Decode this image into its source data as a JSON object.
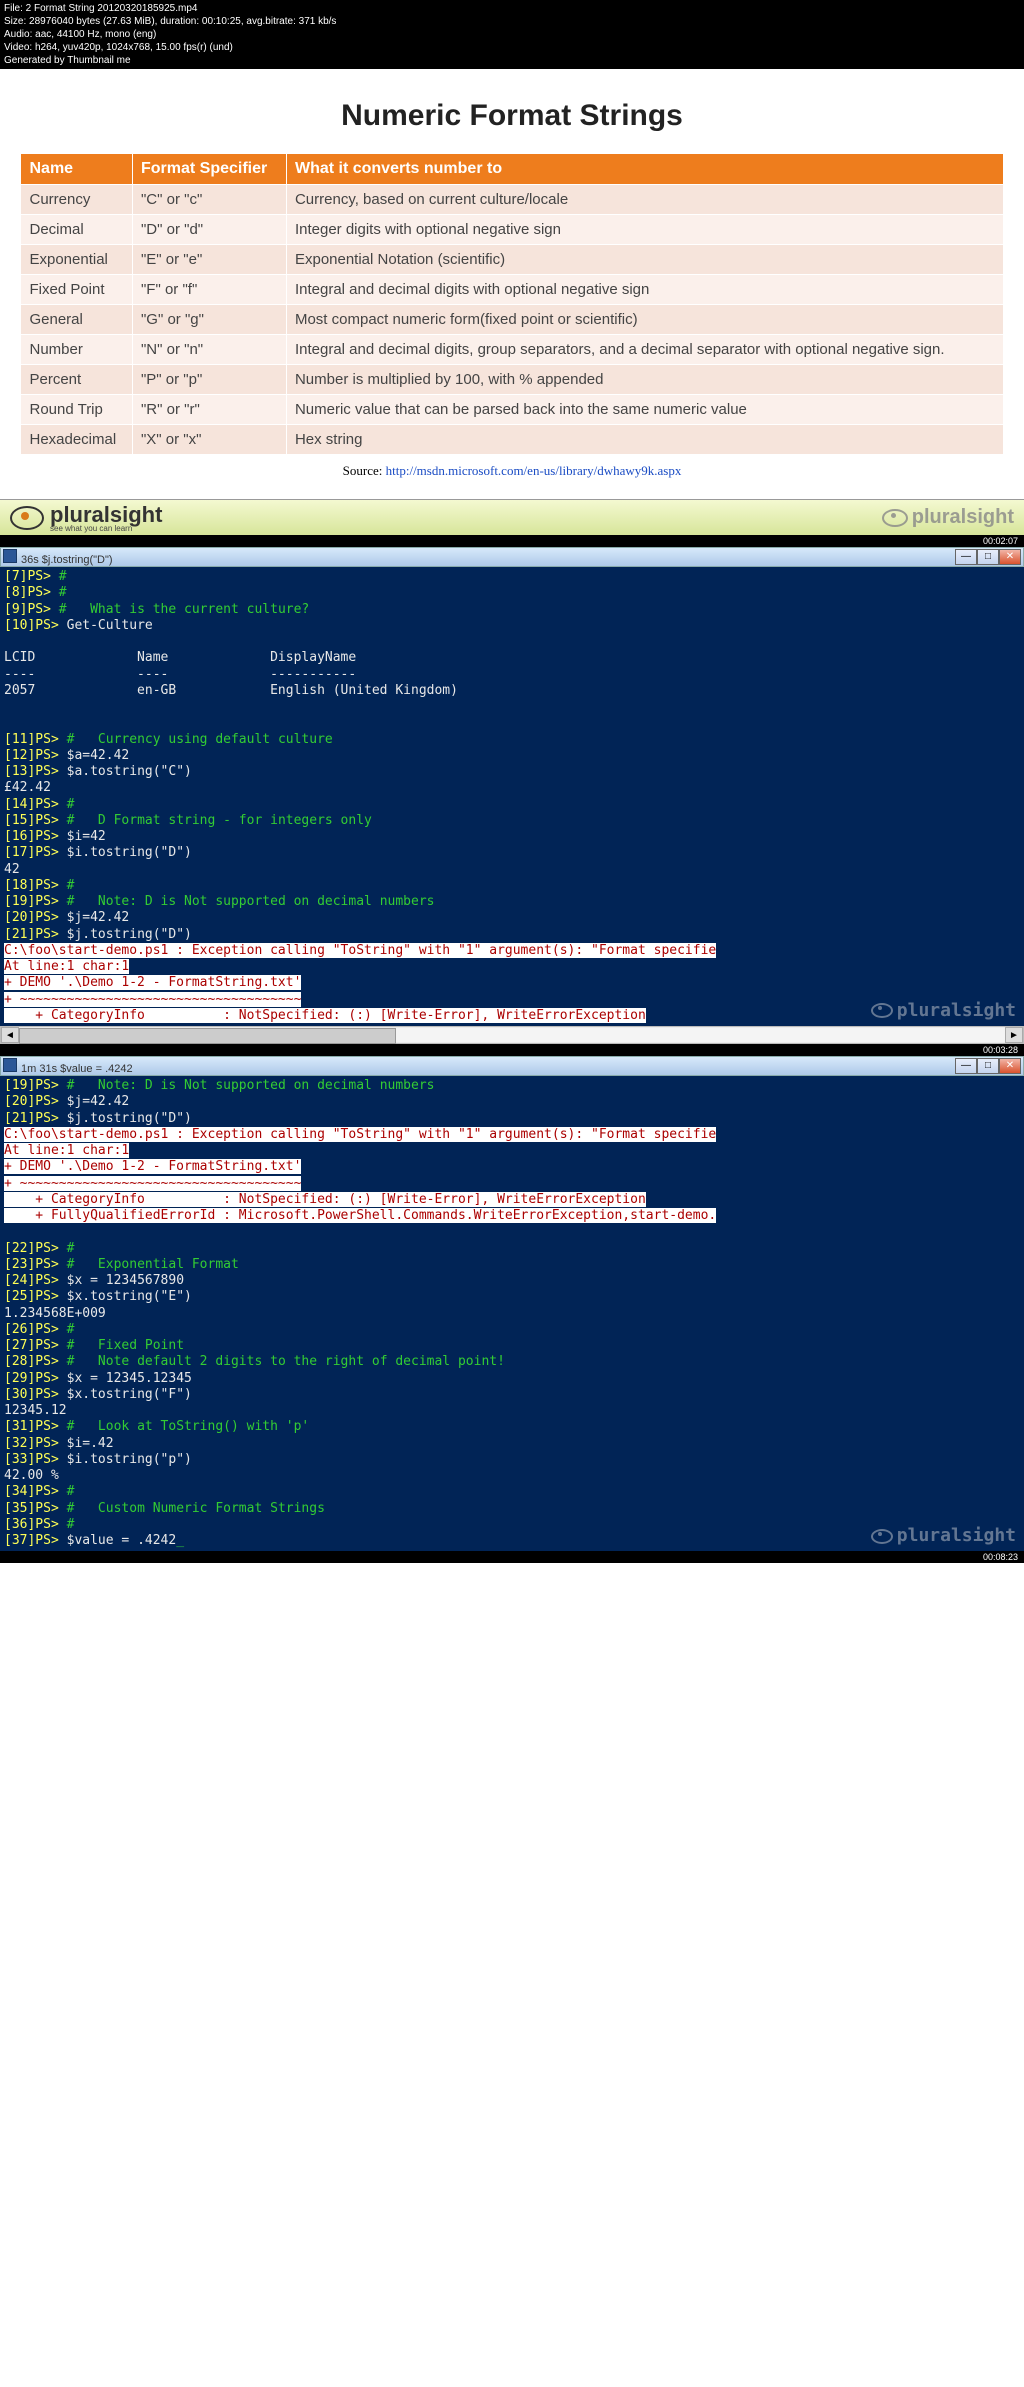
{
  "file_info": {
    "line1": "File: 2 Format String 20120320185925.mp4",
    "line2": "Size: 28976040 bytes (27.63 MiB), duration: 00:10:25, avg.bitrate: 371 kb/s",
    "line3": "Audio: aac, 44100 Hz, mono (eng)",
    "line4": "Video: h264, yuv420p, 1024x768, 15.00 fps(r) (und)",
    "line5": "Generated by Thumbnail me"
  },
  "slide": {
    "title": "Numeric Format Strings",
    "headers": {
      "c1": "Name",
      "c2": "Format Specifier",
      "c3": "What it converts number to"
    },
    "rows": [
      {
        "name": "Currency",
        "spec": "\"C\" or \"c\"",
        "desc": "Currency, based on current culture/locale"
      },
      {
        "name": "Decimal",
        "spec": "\"D\" or \"d\"",
        "desc": "Integer digits with optional negative sign"
      },
      {
        "name": "Exponential",
        "spec": "\"E\" or \"e\"",
        "desc": "Exponential Notation (scientific)"
      },
      {
        "name": "Fixed Point",
        "spec": "\"F\" or \"f\"",
        "desc": "Integral and decimal digits with optional negative sign"
      },
      {
        "name": "General",
        "spec": "\"G\" or \"g\"",
        "desc": "Most compact numeric form(fixed point or scientific)"
      },
      {
        "name": "Number",
        "spec": "\"N\" or \"n\"",
        "desc": "Integral and decimal digits, group separators, and a decimal separator with optional negative sign."
      },
      {
        "name": "Percent",
        "spec": "\"P\" or \"p\"",
        "desc": "Number is multiplied by 100, with % appended"
      },
      {
        "name": "Round Trip",
        "spec": "\"R\" or \"r\"",
        "desc": "Numeric value that can be parsed back into the same numeric value"
      },
      {
        "name": "Hexadecimal",
        "spec": "\"X\" or \"x\"",
        "desc": "Hex string"
      }
    ],
    "source_label": "Source: ",
    "source_url": "http://msdn.microsoft.com/en-us/library/dwhawy9k.aspx"
  },
  "brand": {
    "name": "pluralsight",
    "tag": "see what you can learn"
  },
  "frame2": {
    "timecode": "00:02:07",
    "win_title": "36s  $j.tostring(\"D\")",
    "lines": [
      {
        "p": "[7]PS>",
        "c": "#"
      },
      {
        "p": "[8]PS>",
        "c": "#"
      },
      {
        "p": "[9]PS>",
        "c": "#   What is the current culture?"
      },
      {
        "p": "[10]PS>",
        "c": "Get-Culture",
        "white": true
      }
    ],
    "table_header": "LCID             Name             DisplayName",
    "table_divider": "----             ----             -----------",
    "table_row": "2057             en-GB            English (United Kingdom)",
    "lines2": [
      {
        "p": "[11]PS>",
        "c": "#   Currency using default culture"
      },
      {
        "p": "[12]PS>",
        "c": "$a=42.42",
        "white": true
      },
      {
        "p": "[13]PS>",
        "c": "$a.tostring(\"C\")",
        "white": true
      }
    ],
    "out1": "£42.42",
    "lines3": [
      {
        "p": "[14]PS>",
        "c": "#"
      },
      {
        "p": "[15]PS>",
        "c": "#   D Format string - for integers only"
      },
      {
        "p": "[16]PS>",
        "c": "$i=42",
        "white": true
      },
      {
        "p": "[17]PS>",
        "c": "$i.tostring(\"D\")",
        "white": true
      }
    ],
    "out2": "42",
    "lines4": [
      {
        "p": "[18]PS>",
        "c": "#"
      },
      {
        "p": "[19]PS>",
        "c": "#   Note: D is Not supported on decimal numbers"
      },
      {
        "p": "[20]PS>",
        "c": "$j=42.42",
        "white": true
      },
      {
        "p": "[21]PS>",
        "c": "$j.tostring(\"D\")",
        "white": true
      }
    ],
    "err1": "C:\\foo\\start-demo.ps1 : Exception calling \"ToString\" with \"1\" argument(s): \"Format specifie",
    "err2": "At line:1 char:1",
    "err3": "+ DEMO '.\\Demo 1-2 - FormatString.txt'",
    "err4": "+ ~~~~~~~~~~~~~~~~~~~~~~~~~~~~~~~~~~~~",
    "err5": "    + CategoryInfo          : NotSpecified: (:) [Write-Error], WriteErrorException"
  },
  "frame3": {
    "timecode": "00:03:28",
    "timecode2": "00:08:23",
    "win_title": "1m 31s  $value = .4242",
    "lines1": [
      {
        "p": "[19]PS>",
        "c": "#   Note: D is Not supported on decimal numbers"
      },
      {
        "p": "[20]PS>",
        "c": "$j=42.42",
        "white": true
      },
      {
        "p": "[21]PS>",
        "c": "$j.tostring(\"D\")",
        "white": true
      }
    ],
    "err1": "C:\\foo\\start-demo.ps1 : Exception calling \"ToString\" with \"1\" argument(s): \"Format specifie",
    "err2": "At line:1 char:1",
    "err3": "+ DEMO '.\\Demo 1-2 - FormatString.txt'",
    "err4": "+ ~~~~~~~~~~~~~~~~~~~~~~~~~~~~~~~~~~~~",
    "err5": "    + CategoryInfo          : NotSpecified: (:) [Write-Error], WriteErrorException",
    "err6": "    + FullyQualifiedErrorId : Microsoft.PowerShell.Commands.WriteErrorException,start-demo.",
    "lines2": [
      {
        "p": "[22]PS>",
        "c": "#"
      },
      {
        "p": "[23]PS>",
        "c": "#   Exponential Format"
      },
      {
        "p": "[24]PS>",
        "c": "$x = 1234567890",
        "white": true
      },
      {
        "p": "[25]PS>",
        "c": "$x.tostring(\"E\")",
        "white": true
      }
    ],
    "out1": "1.234568E+009",
    "lines3": [
      {
        "p": "[26]PS>",
        "c": "#"
      },
      {
        "p": "[27]PS>",
        "c": "#   Fixed Point"
      },
      {
        "p": "[28]PS>",
        "c": "#   Note default 2 digits to the right of decimal point!"
      },
      {
        "p": "[29]PS>",
        "c": "$x = 12345.12345",
        "white": true
      },
      {
        "p": "[30]PS>",
        "c": "$x.tostring(\"F\")",
        "white": true
      }
    ],
    "out2": "12345.12",
    "lines4": [
      {
        "p": "[31]PS>",
        "c": "#   Look at ToString() with 'p'"
      },
      {
        "p": "[32]PS>",
        "c": "$i=.42",
        "white": true
      },
      {
        "p": "[33]PS>",
        "c": "$i.tostring(\"p\")",
        "white": true
      }
    ],
    "out3": "42.00 %",
    "lines5": [
      {
        "p": "[34]PS>",
        "c": "#"
      },
      {
        "p": "[35]PS>",
        "c": "#   Custom Numeric Format Strings"
      },
      {
        "p": "[36]PS>",
        "c": "#"
      },
      {
        "p": "[37]PS>",
        "c": "$value = .4242",
        "white": true,
        "cursor": true
      }
    ]
  },
  "chart_data": {
    "type": "table",
    "title": "Numeric Format Strings",
    "columns": [
      "Name",
      "Format Specifier",
      "What it converts number to"
    ],
    "rows": [
      [
        "Currency",
        "\"C\" or \"c\"",
        "Currency, based on current culture/locale"
      ],
      [
        "Decimal",
        "\"D\" or \"d\"",
        "Integer digits with optional negative sign"
      ],
      [
        "Exponential",
        "\"E\" or \"e\"",
        "Exponential Notation (scientific)"
      ],
      [
        "Fixed Point",
        "\"F\" or \"f\"",
        "Integral and decimal digits with optional negative sign"
      ],
      [
        "General",
        "\"G\" or \"g\"",
        "Most compact numeric form(fixed point or scientific)"
      ],
      [
        "Number",
        "\"N\" or \"n\"",
        "Integral and decimal digits, group separators, and a decimal separator with optional negative sign."
      ],
      [
        "Percent",
        "\"P\" or \"p\"",
        "Number is multiplied by 100, with % appended"
      ],
      [
        "Round Trip",
        "\"R\" or \"r\"",
        "Numeric value that can be parsed back into the same numeric value"
      ],
      [
        "Hexadecimal",
        "\"X\" or \"x\"",
        "Hex string"
      ]
    ]
  }
}
